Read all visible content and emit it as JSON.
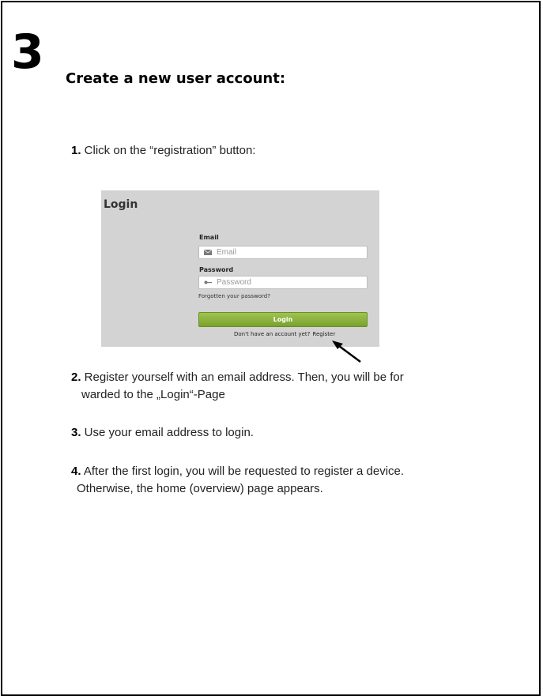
{
  "page": {
    "step_number": "3",
    "heading": "Create a new user account:"
  },
  "steps": [
    {
      "num": "1.",
      "text": " Click on the “registration” button:"
    },
    {
      "num": "2.",
      "text": "  Register yourself with an email address. Then, you will be for",
      "text2": "warded to the „Login“-Page"
    },
    {
      "num": "3.",
      "text": "  Use your email address to login."
    },
    {
      "num": "4.",
      "text": "  After the first login, you will be requested to register a device.",
      "text2": "Otherwise, the home (overview) page appears."
    }
  ],
  "login_screenshot": {
    "title": "Login",
    "email_label": "Email",
    "email_placeholder": "Email",
    "password_label": "Password",
    "password_placeholder": "Password",
    "forgot_link": "Forgotten your password?",
    "login_button": "Login",
    "no_account_text": "Don't have an account yet?",
    "register_link": "Register",
    "colors": {
      "background": "#d3d3d3",
      "button": "#8db640"
    }
  },
  "icons": {
    "email_icon": "envelope-icon",
    "password_icon": "key-icon",
    "pointer": "arrow-icon"
  }
}
